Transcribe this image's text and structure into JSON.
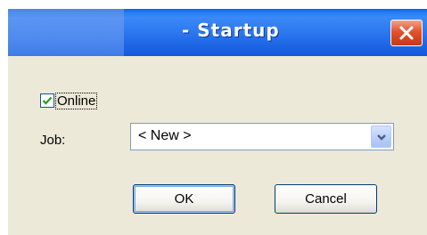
{
  "window": {
    "title": "- Startup"
  },
  "icons": {
    "close": "close-icon",
    "check": "checkmark-icon",
    "dropdown": "chevron-down-icon"
  },
  "colors": {
    "titlebar": "#2f7bf2",
    "close_button": "#e2512c",
    "dialog_bg": "#ece9d8",
    "checkmark": "#21a121",
    "arrow": "#4d6185"
  },
  "form": {
    "online_label": "Online",
    "online_checked": true,
    "job_label": "Job:",
    "job_value": "< New >"
  },
  "buttons": {
    "ok": "OK",
    "cancel": "Cancel"
  }
}
